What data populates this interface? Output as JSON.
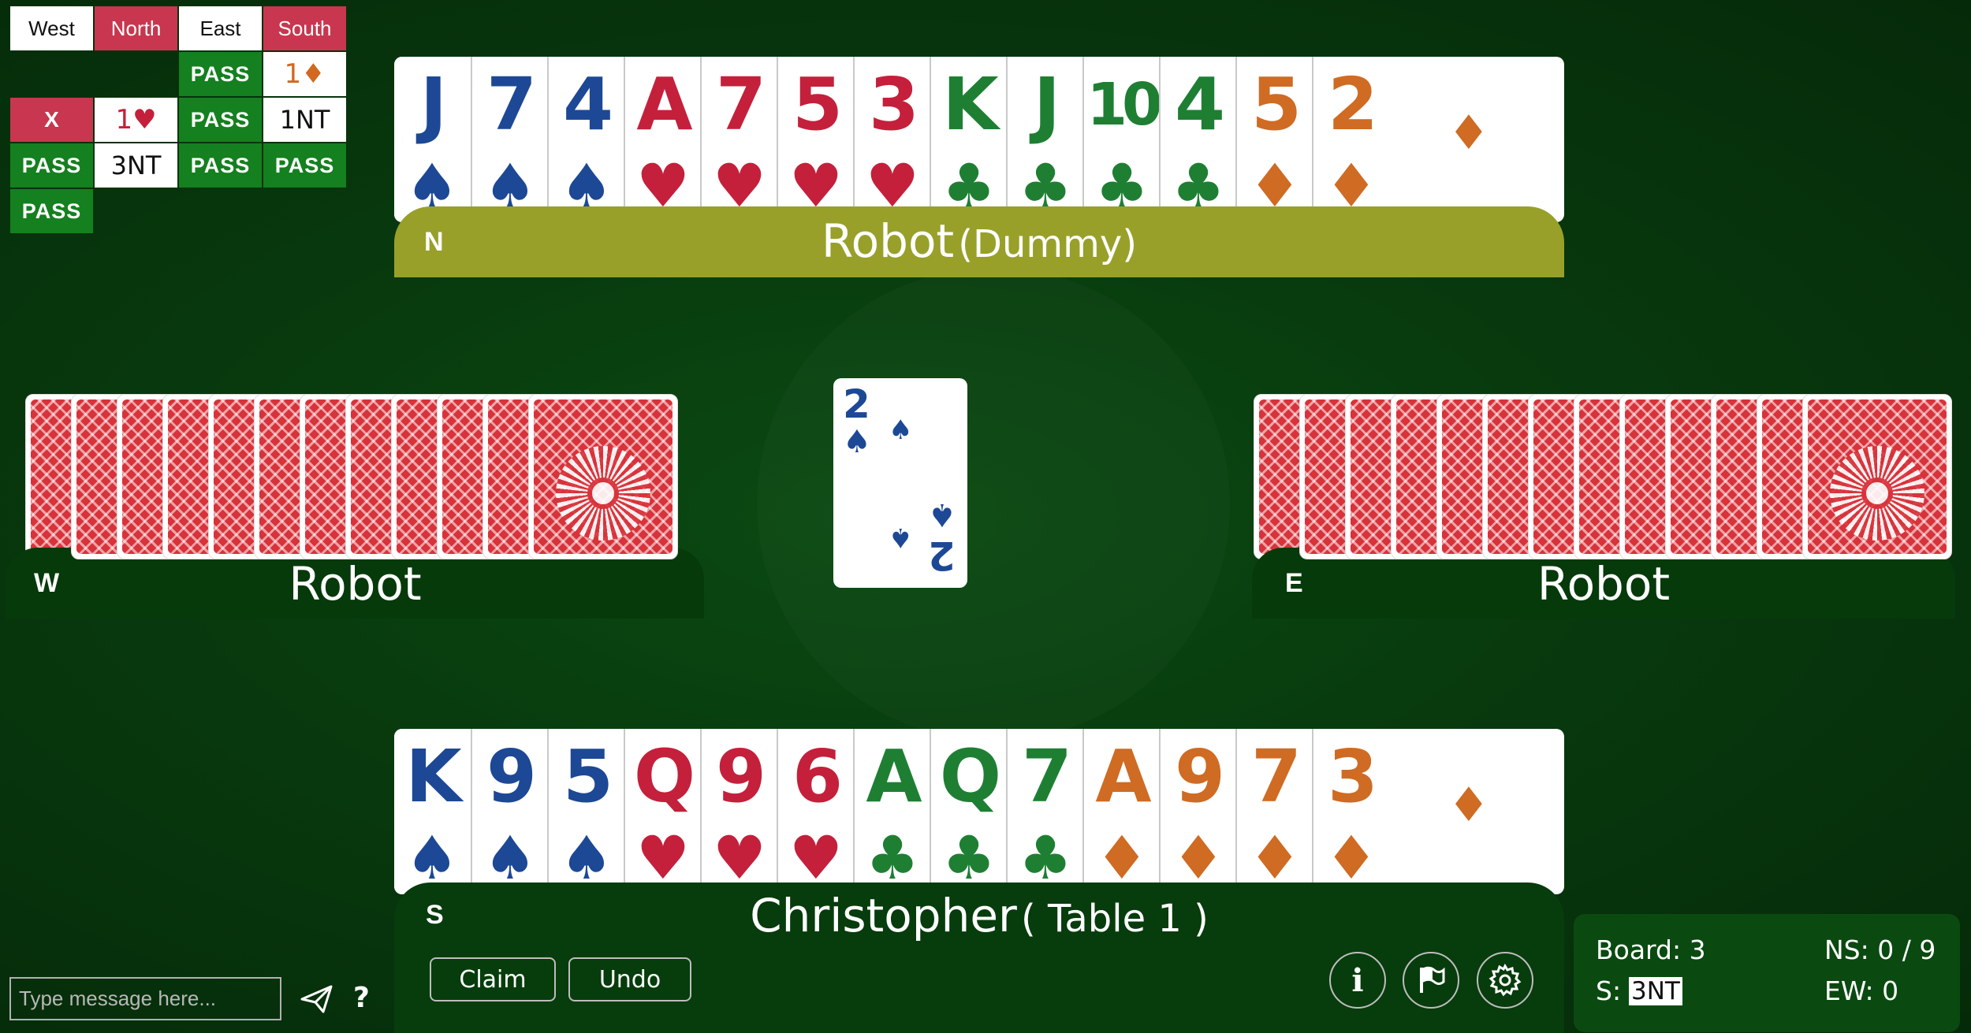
{
  "bidding": {
    "headers": [
      {
        "label": "West",
        "vuln": false
      },
      {
        "label": "North",
        "vuln": true
      },
      {
        "label": "East",
        "vuln": false
      },
      {
        "label": "South",
        "vuln": true
      }
    ],
    "row1": {
      "east": "PASS",
      "south_level": "1",
      "south_suit": "♦"
    },
    "row2": {
      "west": "X",
      "north_level": "1",
      "north_suit": "♥",
      "east": "PASS",
      "south": "1NT"
    },
    "row3": {
      "west": "PASS",
      "north": "3NT",
      "east": "PASS",
      "south": "PASS"
    },
    "row4": {
      "west": "PASS"
    }
  },
  "north": {
    "direction": "N",
    "name": "Robot",
    "role": "(Dummy)",
    "cards": [
      {
        "rank": "J",
        "suit": "♠",
        "color": "s"
      },
      {
        "rank": "7",
        "suit": "♠",
        "color": "s"
      },
      {
        "rank": "4",
        "suit": "♠",
        "color": "s"
      },
      {
        "rank": "A",
        "suit": "♥",
        "color": "h"
      },
      {
        "rank": "7",
        "suit": "♥",
        "color": "h"
      },
      {
        "rank": "5",
        "suit": "♥",
        "color": "h"
      },
      {
        "rank": "3",
        "suit": "♥",
        "color": "h"
      },
      {
        "rank": "K",
        "suit": "♣",
        "color": "c"
      },
      {
        "rank": "J",
        "suit": "♣",
        "color": "c"
      },
      {
        "rank": "10",
        "suit": "♣",
        "color": "c"
      },
      {
        "rank": "4",
        "suit": "♣",
        "color": "c"
      },
      {
        "rank": "5",
        "suit": "♦",
        "color": "d"
      },
      {
        "rank": "2",
        "suit": "♦",
        "color": "d"
      }
    ],
    "trail_suit": "♦"
  },
  "south": {
    "direction": "S",
    "name": "Christopher",
    "table": "( Table 1 )",
    "cards": [
      {
        "rank": "K",
        "suit": "♠",
        "color": "s"
      },
      {
        "rank": "9",
        "suit": "♠",
        "color": "s"
      },
      {
        "rank": "5",
        "suit": "♠",
        "color": "s"
      },
      {
        "rank": "Q",
        "suit": "♥",
        "color": "h"
      },
      {
        "rank": "9",
        "suit": "♥",
        "color": "h"
      },
      {
        "rank": "6",
        "suit": "♥",
        "color": "h"
      },
      {
        "rank": "A",
        "suit": "♣",
        "color": "c"
      },
      {
        "rank": "Q",
        "suit": "♣",
        "color": "c"
      },
      {
        "rank": "7",
        "suit": "♣",
        "color": "c"
      },
      {
        "rank": "A",
        "suit": "♦",
        "color": "d"
      },
      {
        "rank": "9",
        "suit": "♦",
        "color": "d"
      },
      {
        "rank": "7",
        "suit": "♦",
        "color": "d"
      },
      {
        "rank": "3",
        "suit": "♦",
        "color": "d"
      }
    ],
    "trail_suit": "♦"
  },
  "west": {
    "direction": "W",
    "name": "Robot",
    "card_count": 12
  },
  "east": {
    "direction": "E",
    "name": "Robot",
    "card_count": 13
  },
  "trick": {
    "rank": "2",
    "suit": "♠"
  },
  "controls": {
    "claim": "Claim",
    "undo": "Undo"
  },
  "icons": {
    "info": "info-icon",
    "flag": "flag-icon",
    "settings": "gear-icon",
    "send": "send-icon",
    "help": "?"
  },
  "chat": {
    "placeholder": "Type message here..."
  },
  "status": {
    "board_label": "Board: 3",
    "contract_label": "S:",
    "contract": "3NT",
    "ns": "NS: 0 / 9",
    "ew": "EW: 0"
  },
  "colors": {
    "spade": "#1d4895",
    "heart": "#c4203b",
    "club": "#1e7f33",
    "diamond": "#cf6b23",
    "table": "#0b4a12",
    "dummy_plate": "#98a02a"
  }
}
